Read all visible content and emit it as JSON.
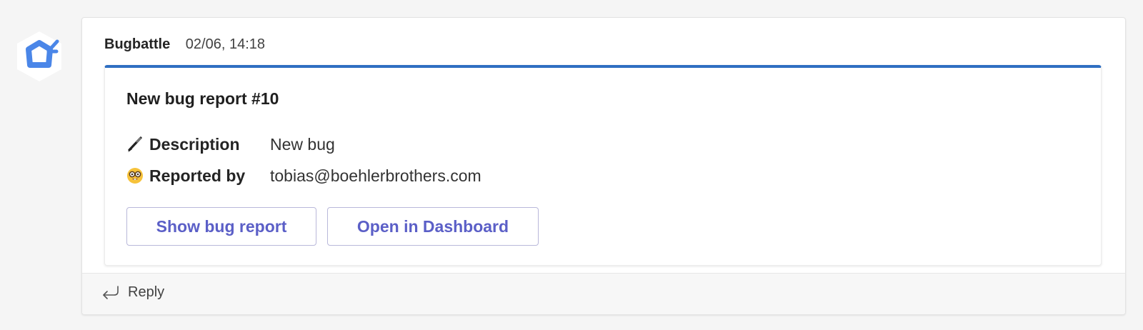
{
  "message": {
    "sender": "Bugbattle",
    "timestamp": "02/06, 14:18"
  },
  "card": {
    "title": "New bug report #10",
    "accent_color": "#2f6fc2",
    "facts": [
      {
        "icon": "pen-icon",
        "label": "Description",
        "value": "New bug"
      },
      {
        "icon": "nerd-face-icon",
        "label": "Reported by",
        "value": "tobias@boehlerbrothers.com"
      }
    ],
    "actions": [
      {
        "label": "Show bug report"
      },
      {
        "label": "Open in Dashboard"
      }
    ],
    "button_color": "#5b5fc7"
  },
  "reply": {
    "label": "Reply",
    "icon": "reply-arrow-icon"
  },
  "avatar": {
    "icon": "bugbattle-logo-icon",
    "brand_color": "#4a86e8"
  }
}
